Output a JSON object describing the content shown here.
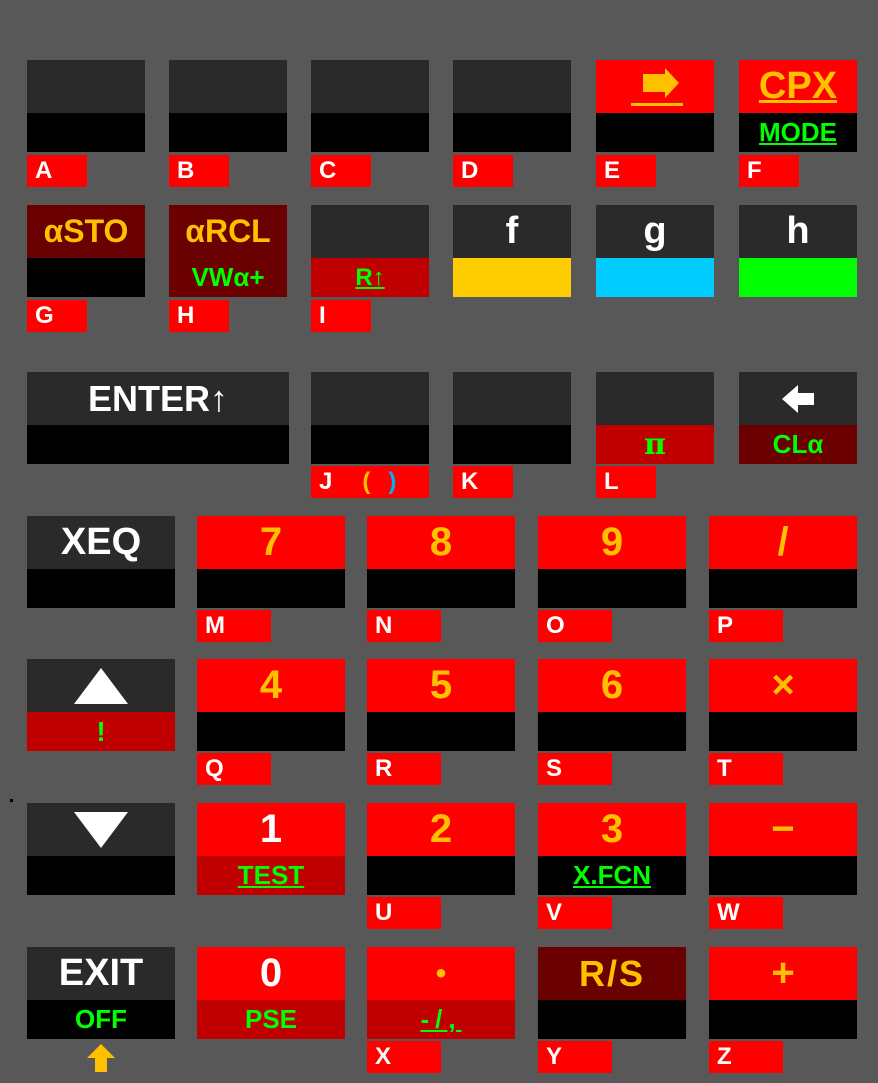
{
  "colors": {
    "background": "#585858",
    "key_dark": "#2a2a2a",
    "key_black": "#000000",
    "key_red": "#ff0000",
    "key_darkred": "#6b0000",
    "key_midred": "#c00000",
    "label_orange": "#ffc000",
    "label_green": "#00ff00",
    "f_yellow": "#ffcc00",
    "g_cyan": "#00ccff",
    "h_green": "#00ff00",
    "white": "#ffffff"
  },
  "row1": {
    "e_right_arrow_icon": "right-arrow-icon",
    "f_top": "CPX",
    "f_bottom": "MODE",
    "tags": [
      "A",
      "B",
      "C",
      "D",
      "E",
      "F"
    ]
  },
  "row2": {
    "g_top": "αSTO",
    "h_top": "αRCL",
    "h_bottom": "VWα+",
    "i_bottom": "R↑",
    "f_key": "f",
    "g_key": "g",
    "h_key": "h",
    "tags": [
      "G",
      "H",
      "I"
    ]
  },
  "row3": {
    "enter": "ENTER↑",
    "pi": "π",
    "cla": "CLα",
    "backspace_icon": "left-arrow-icon",
    "tag_j": "J",
    "tag_j_open": "(",
    "tag_j_close": ")",
    "tag_k": "K",
    "tag_l": "L"
  },
  "row4": {
    "xeq": "XEQ",
    "k7": "7",
    "k8": "8",
    "k9": "9",
    "div": "/",
    "tags": [
      "M",
      "N",
      "O",
      "P"
    ]
  },
  "row5": {
    "up_icon": "up-triangle-icon",
    "up_bottom": "!",
    "k4": "4",
    "k5": "5",
    "k6": "6",
    "mul": "×",
    "tags": [
      "Q",
      "R",
      "S",
      "T"
    ]
  },
  "row6": {
    "down_icon": "down-triangle-icon",
    "k1": "1",
    "k1_bottom": "TEST",
    "k2": "2",
    "k3": "3",
    "k3_bottom": "X.FCN",
    "sub": "−",
    "tags": [
      "U",
      "V",
      "W"
    ]
  },
  "row7": {
    "exit": "EXIT",
    "exit_bottom": "OFF",
    "shift_icon": "up-arrow-icon",
    "k0": "0",
    "k0_bottom": "PSE",
    "dot": "•",
    "dot_bottom": "-/,",
    "rs": "R/S",
    "add": "+",
    "tags": [
      "X",
      "Y",
      "Z"
    ]
  }
}
